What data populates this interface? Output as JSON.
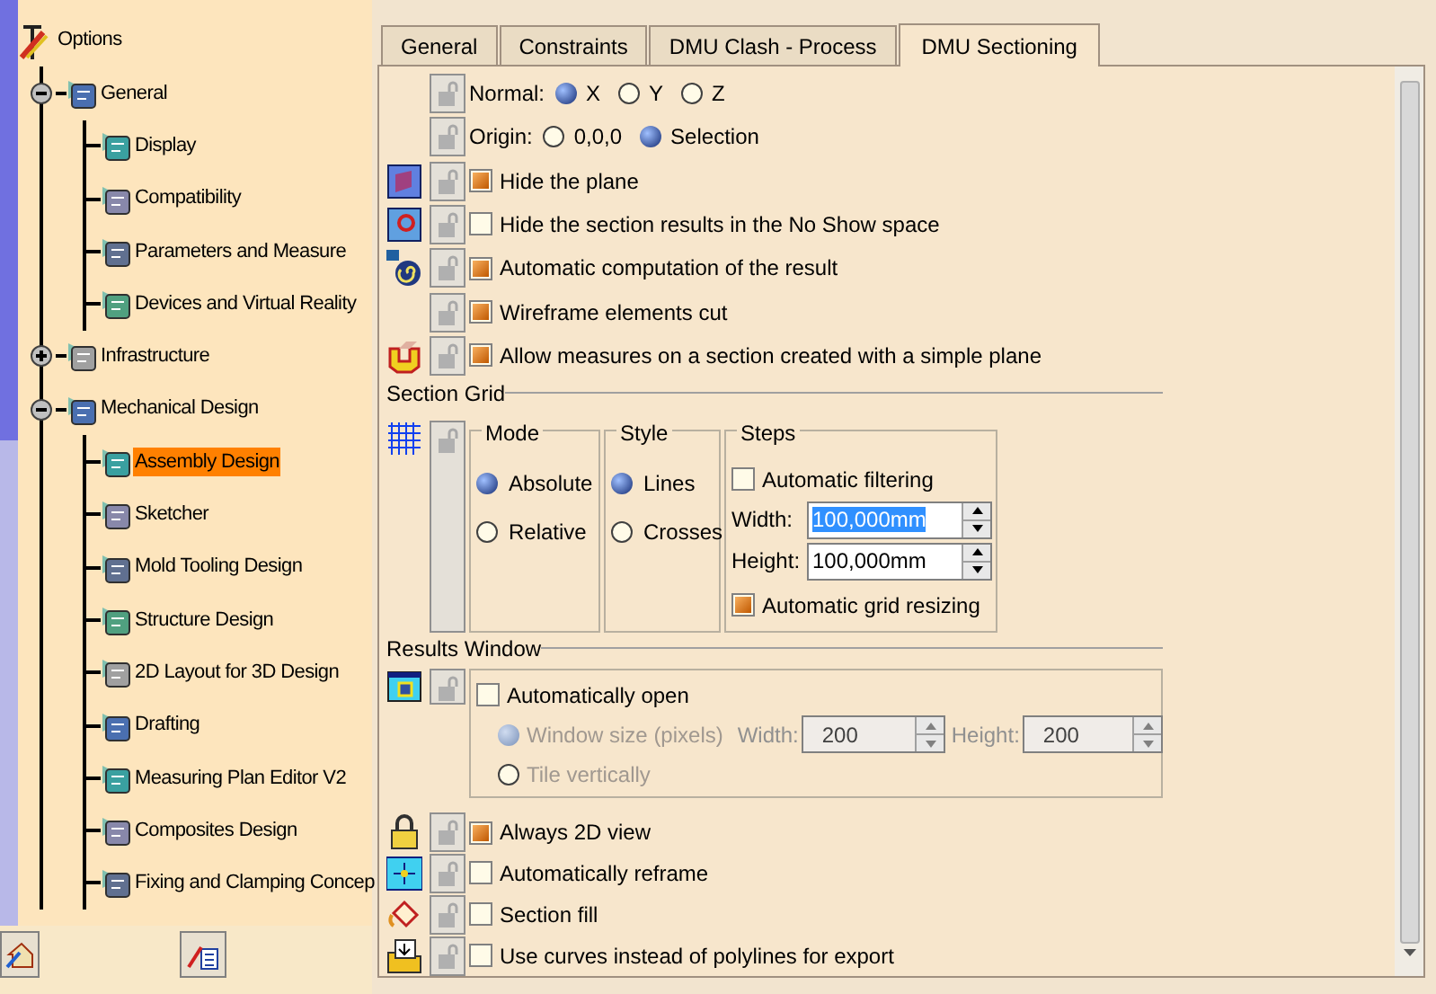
{
  "tree": {
    "label": "Options",
    "selected": false,
    "children": [
      {
        "label": "General",
        "selected": false,
        "expanded": true,
        "children": [
          {
            "label": "Display",
            "selected": false
          },
          {
            "label": "Compatibility",
            "selected": false
          },
          {
            "label": "Parameters and Measure",
            "selected": false
          },
          {
            "label": "Devices and Virtual Reality",
            "selected": false
          }
        ]
      },
      {
        "label": "Infrastructure",
        "selected": false,
        "expanded": false
      },
      {
        "label": "Mechanical Design",
        "selected": false,
        "expanded": true,
        "children": [
          {
            "label": "Assembly Design",
            "selected": true
          },
          {
            "label": "Sketcher",
            "selected": false
          },
          {
            "label": "Mold Tooling Design",
            "selected": false
          },
          {
            "label": "Structure Design",
            "selected": false
          },
          {
            "label": "2D Layout for 3D Design",
            "selected": false
          },
          {
            "label": "Drafting",
            "selected": false
          },
          {
            "label": "Measuring Plan Editor V2",
            "selected": false
          },
          {
            "label": "Composites Design",
            "selected": false
          },
          {
            "label": "Fixing and Clamping Concep",
            "selected": false
          }
        ]
      }
    ]
  },
  "tabs": [
    {
      "label": "General",
      "selected": false
    },
    {
      "label": "Constraints",
      "selected": false
    },
    {
      "label": "DMU Clash - Process",
      "selected": false
    },
    {
      "label": "DMU Sectioning",
      "selected": true
    }
  ],
  "normal": {
    "label": "Normal:",
    "options": [
      {
        "label": "X",
        "selected": true
      },
      {
        "label": "Y",
        "selected": false
      },
      {
        "label": "Z",
        "selected": false
      }
    ]
  },
  "origin": {
    "label": "Origin:",
    "options": [
      {
        "label": "0,0,0",
        "selected": false
      },
      {
        "label": "Selection",
        "selected": true
      }
    ]
  },
  "options": [
    {
      "label": "Hide the plane",
      "checked": true
    },
    {
      "label": "Hide the section results in the No Show space",
      "checked": false
    },
    {
      "label": "Automatic computation of the result",
      "checked": true
    },
    {
      "label": "Wireframe elements cut",
      "checked": true
    },
    {
      "label": "Allow measures on a section created with a simple plane",
      "checked": true
    }
  ],
  "section_grid": {
    "title": "Section Grid",
    "mode": {
      "title": "Mode",
      "options": [
        {
          "label": "Absolute",
          "selected": true
        },
        {
          "label": "Relative",
          "selected": false
        }
      ]
    },
    "style": {
      "title": "Style",
      "options": [
        {
          "label": "Lines",
          "selected": true
        },
        {
          "label": "Crosses",
          "selected": false
        }
      ]
    },
    "steps": {
      "title": "Steps",
      "automatic_filtering": {
        "label": "Automatic filtering",
        "checked": false
      },
      "width": {
        "label": "Width:",
        "value": "100,000mm",
        "highlighted": true
      },
      "height": {
        "label": "Height:",
        "value": "100,000mm",
        "highlighted": false
      },
      "automatic_grid_resizing": {
        "label": "Automatic grid resizing",
        "checked": true
      }
    }
  },
  "results_window": {
    "title": "Results Window",
    "automatically_open": {
      "label": "Automatically open",
      "checked": false
    },
    "window_size": {
      "label": "Window size (pixels)",
      "selected": true,
      "disabled": true
    },
    "width": {
      "label": "Width:",
      "value": "200",
      "disabled": true
    },
    "height": {
      "label": "Height:",
      "value": "200",
      "disabled": true
    },
    "tile_vertically": {
      "label": "Tile vertically",
      "selected": false,
      "disabled": true
    }
  },
  "bottom_options": [
    {
      "label": "Always 2D view",
      "checked": true
    },
    {
      "label": "Automatically reframe",
      "checked": false
    },
    {
      "label": "Section fill",
      "checked": false
    },
    {
      "label": "Use curves instead of polylines for export",
      "checked": false
    }
  ]
}
